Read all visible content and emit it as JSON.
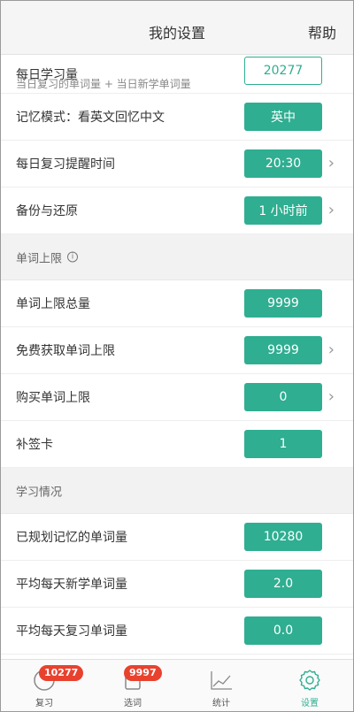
{
  "header": {
    "title": "我的设置",
    "help": "帮助"
  },
  "daily": {
    "label": "每日学习量",
    "sublabel": "当日复习的单词量 + 当日新学单词量",
    "value": "20277"
  },
  "rows_a": [
    {
      "label": "记忆模式：看英文回忆中文",
      "value": "英中",
      "chevron": false
    },
    {
      "label": "每日复习提醒时间",
      "value": "20:30",
      "chevron": true
    },
    {
      "label": "备份与还原",
      "value": "1 小时前",
      "chevron": true
    }
  ],
  "section_limits": {
    "title": "单词上限"
  },
  "rows_b": [
    {
      "label": "单词上限总量",
      "value": "9999",
      "chevron": false
    },
    {
      "label": "免费获取单词上限",
      "value": "9999",
      "chevron": true
    },
    {
      "label": "购买单词上限",
      "value": "0",
      "chevron": true
    },
    {
      "label": "补签卡",
      "value": "1",
      "chevron": false
    }
  ],
  "section_study": {
    "title": "学习情况"
  },
  "rows_c": [
    {
      "label": "已规划记忆的单词量",
      "value": "10280"
    },
    {
      "label": "平均每天新学单词量",
      "value": "2.0"
    },
    {
      "label": "平均每天复习单词量",
      "value": "0.0"
    }
  ],
  "tabbar": {
    "review": {
      "label": "复习",
      "count": "10277"
    },
    "words": {
      "label": "选词",
      "count": "9997"
    },
    "stats": {
      "label": "统计"
    },
    "settings": {
      "label": "设置"
    }
  },
  "colors": {
    "accent": "#2fae91",
    "badge_red": "#e8422f"
  },
  "icons": {
    "chevron": "chevron-right-icon",
    "info": "info-icon"
  }
}
